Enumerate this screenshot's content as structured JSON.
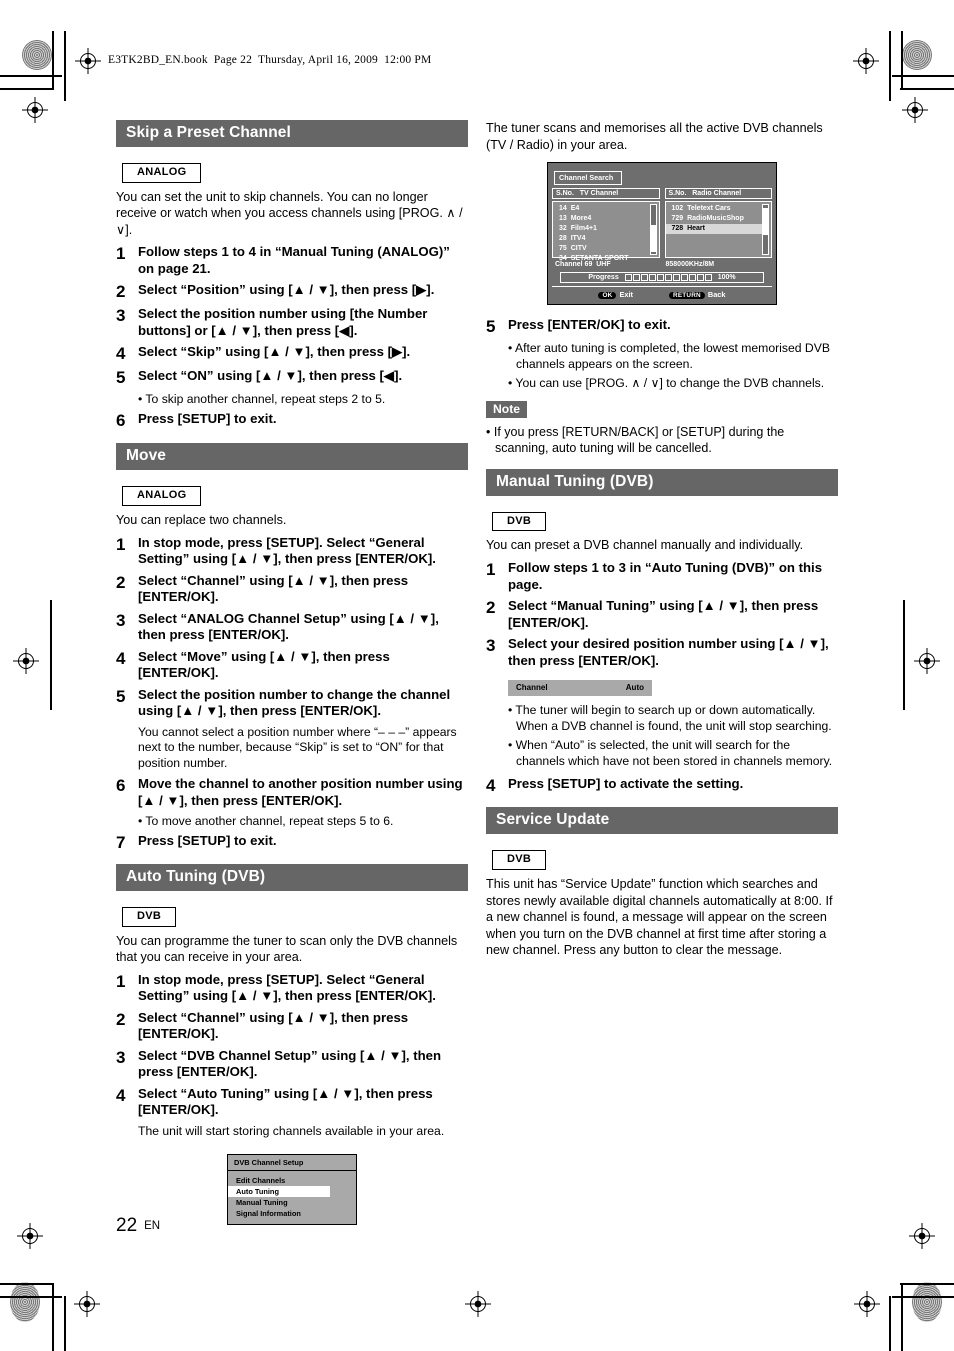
{
  "header": {
    "line": "E3TK2BD_EN.book  Page 22  Thursday, April 16, 2009  12:00 PM"
  },
  "footer": {
    "page_number": "22",
    "language": "EN"
  },
  "left_column": {
    "sections": [
      {
        "title": "Skip a Preset Channel",
        "tag": "ANALOG",
        "intro": "You can set the unit to skip channels. You can no longer receive or watch when you access channels using [PROG. ∧ / ∨].",
        "steps": [
          {
            "num": "1",
            "text": "Follow steps 1 to 4 in “Manual Tuning (ANALOG)” on page 21."
          },
          {
            "num": "2",
            "text": "Select “Position” using [▲ / ▼], then press [▶]."
          },
          {
            "num": "3",
            "text": "Select the position number using [the Number buttons] or [▲ / ▼], then press [◀]."
          },
          {
            "num": "4",
            "text": "Select “Skip” using [▲ / ▼], then press [▶]."
          },
          {
            "num": "5",
            "text": "Select “ON” using [▲ / ▼], then press [◀].",
            "bullet": "• To skip another channel, repeat steps 2 to 5."
          },
          {
            "num": "6",
            "text": "Press [SETUP] to exit."
          }
        ]
      },
      {
        "title": "Move",
        "tag": "ANALOG",
        "intro": "You can replace two channels.",
        "steps": [
          {
            "num": "1",
            "text": "In stop mode, press [SETUP]. Select “General Setting” using [▲ / ▼], then press [ENTER/OK]."
          },
          {
            "num": "2",
            "text": "Select “Channel” using [▲ / ▼], then press [ENTER/OK]."
          },
          {
            "num": "3",
            "text": "Select “ANALOG Channel Setup” using [▲ / ▼], then press [ENTER/OK]."
          },
          {
            "num": "4",
            "text": "Select “Move” using [▲ / ▼], then press [ENTER/OK]."
          },
          {
            "num": "5",
            "text": "Select the position number to change the channel using [▲ / ▼], then press [ENTER/OK].",
            "sub": "You cannot select a position number where “– – –” appears next to the number, because “Skip” is set to “ON” for that position number."
          },
          {
            "num": "6",
            "text": "Move the channel to another position number using [▲ / ▼], then press [ENTER/OK].",
            "bullet": "• To move another channel, repeat steps 5 to 6."
          },
          {
            "num": "7",
            "text": "Press [SETUP] to exit."
          }
        ]
      },
      {
        "title": "Auto Tuning (DVB)",
        "tag": "DVB",
        "intro": "You can programme the tuner to scan only the DVB channels that you can receive in your area.",
        "steps": [
          {
            "num": "1",
            "text": "In stop mode, press [SETUP]. Select “General Setting” using [▲ / ▼], then press [ENTER/OK]."
          },
          {
            "num": "2",
            "text": "Select “Channel” using [▲ / ▼], then press [ENTER/OK]."
          },
          {
            "num": "3",
            "text": "Select “DVB Channel Setup” using [▲ / ▼], then press [ENTER/OK]."
          },
          {
            "num": "4",
            "text": "Select “Auto Tuning” using [▲ / ▼], then press [ENTER/OK].",
            "sub": "The unit will start storing channels available in your area."
          }
        ]
      }
    ]
  },
  "dvb_channel_setup_screen": {
    "title": "DVB Channel Setup",
    "items": [
      "Edit Channels",
      "Auto Tuning",
      "Manual Tuning",
      "Signal Information"
    ],
    "selected_index": 1
  },
  "right_column": {
    "intro": "The tuner scans and memorises all the active DVB channels (TV / Radio) in your area.",
    "after_screen": {
      "steps": [
        {
          "num": "5",
          "text": "Press [ENTER/OK] to exit.",
          "bullets": [
            "• After auto tuning is completed, the lowest memorised DVB channels appears on the screen.",
            "• You can use [PROG. ∧ / ∨] to change the DVB channels."
          ]
        }
      ],
      "note_label": "Note",
      "note_text": "• If you press [RETURN/BACK] or [SETUP] during the scanning, auto tuning will be cancelled."
    },
    "sections": [
      {
        "title": "Manual Tuning (DVB)",
        "tag": "DVB",
        "intro": "You can preset a DVB channel manually and individually.",
        "steps": [
          {
            "num": "1",
            "text": "Follow steps 1 to 3 in “Auto Tuning (DVB)” on this page."
          },
          {
            "num": "2",
            "text": "Select “Manual Tuning” using [▲ / ▼], then press [ENTER/OK]."
          },
          {
            "num": "3",
            "text": "Select your desired position number using [▲ / ▼], then press [ENTER/OK]."
          },
          {
            "num": "4",
            "text": "Press [SETUP] to activate the setting."
          }
        ],
        "bullets": [
          "• The tuner will begin to search up or down automatically. When a DVB channel is found, the unit will stop searching.",
          "• When “Auto” is selected, the unit will search for the channels which have not been stored in channels memory."
        ]
      },
      {
        "title": "Service Update",
        "tag": "DVB",
        "intro": "This unit has “Service Update” function which searches and stores newly available digital channels automatically at 8:00. If a new channel is found, a message will appear on the screen when you turn on the DVB channel at first time after storing a new channel. Press any button to clear the message."
      }
    ]
  },
  "channel_auto_box": {
    "label": "Channel",
    "value": "Auto"
  },
  "channel_search_screen": {
    "title": "Channel Search",
    "tv_header": "S.No.   TV Channel",
    "radio_header": "S.No.   Radio Channel",
    "tv_channels": [
      {
        "no": "14",
        "name": "E4"
      },
      {
        "no": "13",
        "name": "More4"
      },
      {
        "no": "32",
        "name": "Film4+1"
      },
      {
        "no": "28",
        "name": "ITV4"
      },
      {
        "no": "75",
        "name": "CITV"
      },
      {
        "no": "34",
        "name": "SETANTA SPORT"
      }
    ],
    "radio_channels": [
      {
        "no": "102",
        "name": "Teletext Cars",
        "highlight": false
      },
      {
        "no": "729",
        "name": "RadioMusicShop",
        "highlight": false
      },
      {
        "no": "728",
        "name": "Heart",
        "highlight": true
      }
    ],
    "channel_info": "Channel 69  UHF",
    "frequency_info": "858000KHz/8M",
    "progress_label": "Progress",
    "progress_value": "100%",
    "progress_blocks": 11,
    "footer_ok_key": "OK",
    "footer_ok_label": "Exit",
    "footer_return_key": "RETURN",
    "footer_return_label": "Back"
  },
  "colors": {
    "section_bar": "#666666",
    "screen_bg": "#6e6e6e",
    "menu_bg": "#a9a9a9"
  }
}
